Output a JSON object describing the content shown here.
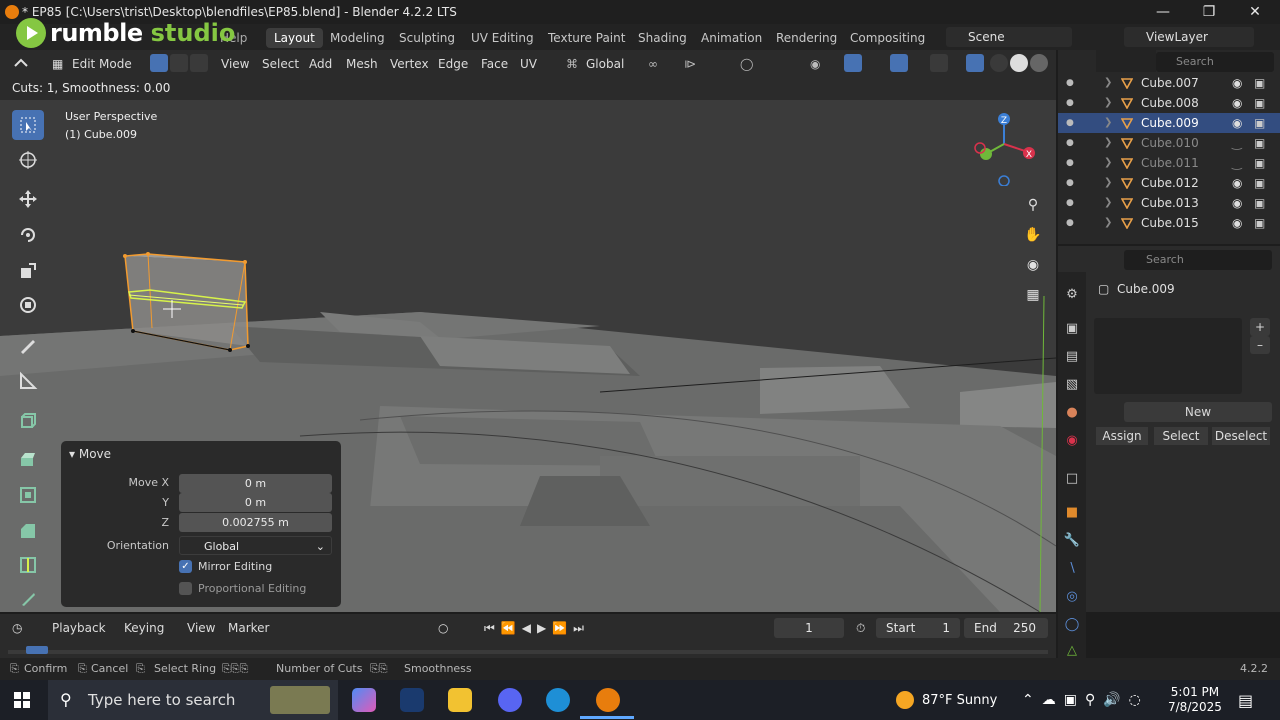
{
  "window": {
    "title": "* EP85 [C:\\Users\\trist\\Desktop\\blendfiles\\EP85.blend] - Blender 4.2.2 LTS",
    "menu_help": "Help",
    "overlay_brand": "rumble",
    "overlay_brand2": "studio"
  },
  "workspaces": [
    "Layout",
    "Modeling",
    "Sculpting",
    "UV Editing",
    "Texture Paint",
    "Shading",
    "Animation",
    "Rendering",
    "Compositing"
  ],
  "scene_name": "Scene",
  "view_layer": "ViewLayer",
  "viewport_header": {
    "mode": "Edit Mode",
    "menus": [
      "View",
      "Select",
      "Add",
      "Mesh",
      "Vertex",
      "Edge",
      "Face",
      "UV"
    ],
    "transform_orientation": "Global"
  },
  "operator_hint": "Cuts: 1, Smoothness: 0.00",
  "viewport": {
    "perspective": "User Perspective",
    "object_label": "(1) Cube.009",
    "gizmo_axes": [
      "Z",
      "X"
    ]
  },
  "move_panel": {
    "title": "Move",
    "move_x_label": "Move X",
    "move_x": "0 m",
    "y_label": "Y",
    "y": "0 m",
    "z_label": "Z",
    "z": "0.002755 m",
    "orientation_label": "Orientation",
    "orientation": "Global",
    "mirror_editing": "Mirror Editing",
    "mirror_checked": true,
    "proportional_editing": "Proportional Editing",
    "proportional_checked": false
  },
  "outliner": {
    "search_placeholder": "Search",
    "rows": [
      {
        "name": "Cube.007",
        "selected": false,
        "dim": false
      },
      {
        "name": "Cube.008",
        "selected": false,
        "dim": false
      },
      {
        "name": "Cube.009",
        "selected": true,
        "dim": false
      },
      {
        "name": "Cube.010",
        "selected": false,
        "dim": true
      },
      {
        "name": "Cube.011",
        "selected": false,
        "dim": true
      },
      {
        "name": "Cube.012",
        "selected": false,
        "dim": false
      },
      {
        "name": "Cube.013",
        "selected": false,
        "dim": false
      },
      {
        "name": "Cube.015",
        "selected": false,
        "dim": false
      }
    ]
  },
  "properties": {
    "search_placeholder": "Search",
    "object_name": "Cube.009",
    "new_label": "New",
    "assign_label": "Assign",
    "select_label": "Select",
    "deselect_label": "Deselect"
  },
  "timeline": {
    "playback": "Playback",
    "keying": "Keying",
    "view": "View",
    "marker": "Marker",
    "current_frame": "1",
    "start_label": "Start",
    "start": "1",
    "end_label": "End",
    "end": "250"
  },
  "statusbar": {
    "confirm": "Confirm",
    "cancel": "Cancel",
    "select_ring": "Select Ring",
    "number_of_cuts": "Number of Cuts",
    "smoothness": "Smoothness",
    "version": "4.2.2"
  },
  "taskbar": {
    "search_placeholder": "Type here to search",
    "weather": "87°F  Sunny",
    "time": "5:01 PM",
    "date": "7/8/2025"
  },
  "colors": {
    "accent_blue": "#4772b3",
    "selection_orange": "#f29b30",
    "loop_cut_yellow": "#d7f24a",
    "rumble_green": "#85c742"
  }
}
